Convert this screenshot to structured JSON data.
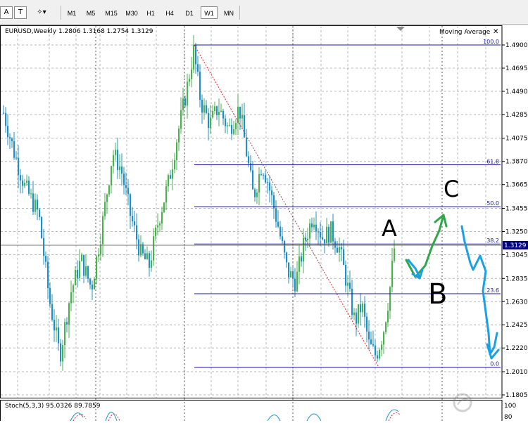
{
  "toolbar": {
    "tools": [
      {
        "name": "text-tool",
        "glyph": "A"
      },
      {
        "name": "text-label-tool",
        "glyph": "T"
      },
      {
        "name": "shapes-tool",
        "glyph": "✧▾"
      }
    ],
    "timeframes": [
      "M1",
      "M5",
      "M15",
      "M30",
      "H1",
      "H4",
      "D1",
      "W1",
      "MN"
    ],
    "active_timeframe": "W1"
  },
  "chart": {
    "header": "EURUSD,Weekly  1.2806 1.3168 1.2754 1.3129",
    "indicator_label": "Moving Average",
    "current_price": "1.3129",
    "price_ticks": [
      "1.4900",
      "1.4695",
      "1.4490",
      "1.4285",
      "1.4075",
      "1.3870",
      "1.3665",
      "1.3455",
      "1.3250",
      "1.3045",
      "1.2835",
      "1.2630",
      "1.2425",
      "1.2220",
      "1.2010",
      "1.1805"
    ],
    "fib_levels": [
      {
        "label": "100.0",
        "price": 1.49
      },
      {
        "label": "61.8",
        "price": 1.384
      },
      {
        "label": "50.0",
        "price": 1.347
      },
      {
        "label": "38.2",
        "price": 1.314
      },
      {
        "label": "23.6",
        "price": 1.27
      },
      {
        "label": "0.0",
        "price": 1.205
      }
    ],
    "annotations": {
      "a": "A",
      "b": "B",
      "c": "C"
    },
    "colors": {
      "bull": "#4caf50",
      "bear": "#1f8fc8",
      "fib": "#1a1aa0",
      "trend": "#d03030",
      "arrow_green": "#2ea84a",
      "arrow_blue": "#1aa0e6",
      "price_tag_bg": "#000080"
    }
  },
  "stochastic": {
    "label": "Stoch(5,3,3) 95.0326 89.7859",
    "scale_top": "100",
    "scale_80": "80"
  }
}
